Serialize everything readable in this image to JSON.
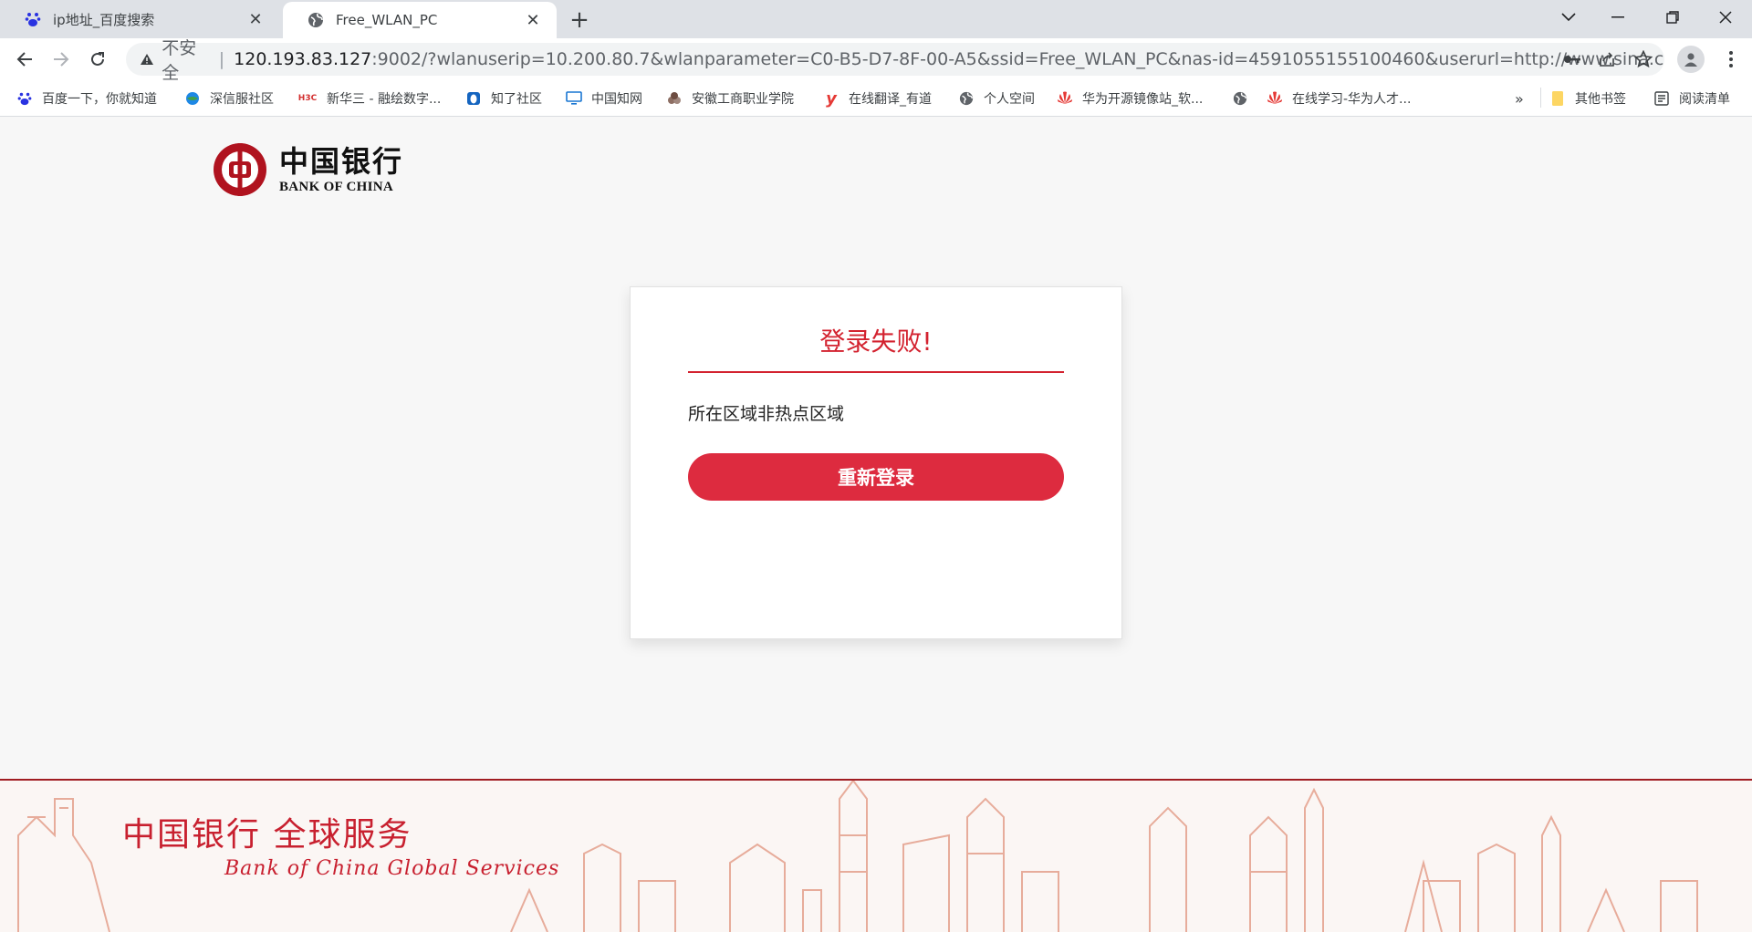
{
  "browser": {
    "tabs": [
      {
        "title": "ip地址_百度搜索",
        "icon": "baidu-paw-icon"
      },
      {
        "title": "Free_WLAN_PC",
        "icon": "globe-icon"
      }
    ],
    "address": {
      "security_label": "不安全",
      "separator": "|",
      "host": "120.193.83.127",
      "path": ":9002/?wlanuserip=10.200.80.7&wlanparameter=C0-B5-D7-8F-00-A5&ssid=Free_WLAN_PC&nas-id=4591055155100460&userurl=http://www.sina.com.cn/"
    },
    "bookmarks": [
      {
        "label": "百度一下，你就知道",
        "icon": "baidu-paw-icon"
      },
      {
        "label": "深信服社区",
        "icon": "sangfor-icon"
      },
      {
        "label": "新华三 - 融绘数字...",
        "icon": "h3c-icon",
        "icon_text": "H3C"
      },
      {
        "label": "知了社区",
        "icon": "zhiliao-icon"
      },
      {
        "label": "中国知网",
        "icon": "monitor-icon"
      },
      {
        "label": "安徽工商职业学院",
        "icon": "school-icon"
      },
      {
        "label": "在线翻译_有道",
        "icon": "youdao-icon",
        "icon_text": "y"
      },
      {
        "label": "个人空间",
        "icon": "globe-icon"
      },
      {
        "label": "华为开源镜像站_软...",
        "icon": "huawei-icon"
      },
      {
        "label": "",
        "icon": "globe-icon"
      },
      {
        "label": "在线学习-华为人才...",
        "icon": "huawei-icon"
      }
    ],
    "overflow_label": "»",
    "other_bookmarks": "其他书签",
    "reading_list": "阅读清单"
  },
  "page": {
    "logo": {
      "cn": "中国银行",
      "en": "BANK OF CHINA"
    },
    "card": {
      "title": "登录失败!",
      "message": "所在区域非热点区域",
      "retry_button": "重新登录"
    },
    "footer": {
      "cn": "中国银行 全球服务",
      "en": "Bank of China   Global Services"
    }
  },
  "colors": {
    "brand_red": "#c8202f",
    "button_red": "#dd2b3f",
    "title_red": "#d3222f"
  }
}
